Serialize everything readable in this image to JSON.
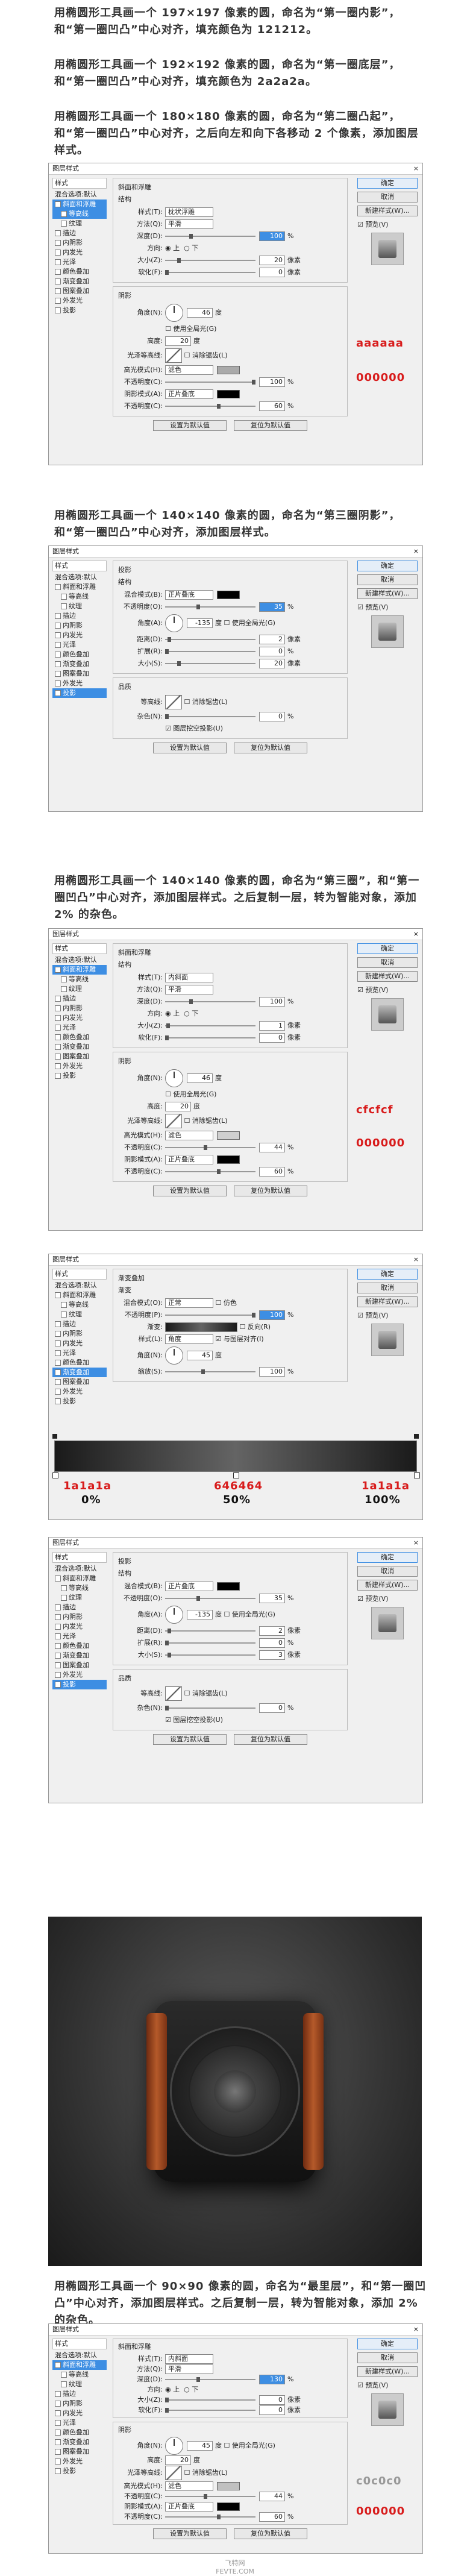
{
  "step1": {
    "p1": "用椭圆形工具画一个 197×197 像素的圆，命名为“第一圈内影”，和“第一圈凹凸”中心对齐，填充颜色为 121212。",
    "p2": "用椭圆形工具画一个 192×192 像素的圆，命名为“第一圈底层”，和“第一圈凹凸”中心对齐，填充颜色为 2a2a2a。",
    "p3": "用椭圆形工具画一个 180×180 像素的圆，命名为“第二圈凸起”，和“第一圈凹凸”中心对齐，之后向左和向下各移动 2 个像素，添加图层样式。"
  },
  "dialog_common": {
    "title": "图层样式",
    "close": "×",
    "styles_header": "样式",
    "blend_options": "混合选项:默认",
    "items": [
      "斜面和浮雕",
      "等高线",
      "纹理",
      "描边",
      "内阴影",
      "内发光",
      "光泽",
      "颜色叠加",
      "渐变叠加",
      "图案叠加",
      "外发光",
      "投影"
    ],
    "ok": "确定",
    "cancel": "取消",
    "new_style": "新建样式(W)...",
    "preview": "预览(V)",
    "set_default": "设置为默认值",
    "reset_default": "复位为默认值"
  },
  "bevel1": {
    "section": "斜面和浮雕",
    "structure": "结构",
    "style_label": "样式(T):",
    "style_value": "枕状浮雕",
    "method_label": "方法(Q):",
    "method_value": "平滑",
    "depth_label": "深度(D):",
    "depth_value": "100",
    "pct": "%",
    "direction_label": "方向:",
    "up": "上",
    "down": "下",
    "size_label": "大小(Z):",
    "size_value": "20",
    "px": "像素",
    "soften_label": "软化(F):",
    "soften_value": "0",
    "shading": "阴影",
    "angle_label": "角度(N):",
    "angle_value": "46",
    "deg": "度",
    "global_light": "使用全局光(G)",
    "altitude_label": "高度:",
    "altitude_value": "20",
    "gloss_label": "光泽等高线:",
    "anti_alias": "消除锯齿(L)",
    "hl_mode_label": "高光模式(H):",
    "hl_mode_value": "滤色",
    "opacity_label": "不透明度(C):",
    "hl_opacity": "100",
    "sh_mode_label": "阴影模式(A):",
    "sh_mode_value": "正片叠底",
    "sh_opacity_label": "不透明度(C):",
    "sh_opacity": "60",
    "note_hl": "aaaaaa",
    "note_sh": "000000",
    "hl_color": "#aaaaaa",
    "sh_color": "#000000"
  },
  "step2": {
    "p": "用椭圆形工具画一个 140×140 像素的圆，命名为“第三圈阴影”，和“第一圈凹凸”中心对齐，添加图层样式。"
  },
  "shadow1": {
    "section": "投影",
    "structure": "结构",
    "blend_label": "混合模式(B):",
    "blend_value": "正片叠底",
    "opacity_label": "不透明度(O):",
    "opacity_value": "35",
    "angle_label": "角度(A):",
    "angle_value": "-135",
    "global_light": "使用全局光(G)",
    "distance_label": "距离(D):",
    "distance_value": "2",
    "spread_label": "扩展(R):",
    "spread_value": "0",
    "size_label": "大小(S):",
    "size_value": "20",
    "quality": "品质",
    "contour_label": "等高线:",
    "anti_alias": "消除锯齿(L)",
    "noise_label": "杂色(N):",
    "noise_value": "0",
    "knockout": "图层挖空投影(U)"
  },
  "step3": {
    "p": "用椭圆形工具画一个 140×140 像素的圆，命名为“第三圈”，和“第一圈凹凸”中心对齐，添加图层样式。之后复制一层，转为智能对象，添加 2% 的杂色。"
  },
  "bevel2": {
    "style_value": "内斜面",
    "method_value": "平滑",
    "depth_value": "100",
    "size_value": "1",
    "soften_value": "0",
    "angle_value": "46",
    "altitude_value": "20",
    "hl_opacity": "44",
    "sh_opacity": "60",
    "note_hl": "cfcfcf",
    "note_sh": "000000",
    "hl_color": "#cfcfcf",
    "sh_color": "#000000"
  },
  "gradient": {
    "section": "渐变叠加",
    "sub": "渐变",
    "blend_label": "混合模式(O):",
    "blend_value": "正常",
    "dither": "仿色",
    "opacity_label": "不透明度(P):",
    "opacity_value": "100",
    "grad_label": "渐变:",
    "reverse": "反向(R)",
    "style_label": "样式(L):",
    "style_value": "角度",
    "align": "与图层对齐(I)",
    "angle_label": "角度(N):",
    "angle_value": "45",
    "scale_label": "缩放(S):",
    "scale_value": "100",
    "stop1": "1a1a1a",
    "stop1_pct": "0%",
    "stop2": "646464",
    "stop2_pct": "50%",
    "stop3": "1a1a1a",
    "stop3_pct": "100%"
  },
  "shadow2": {
    "opacity_value": "35",
    "angle_value": "-135",
    "distance_value": "2",
    "spread_value": "0",
    "size_value": "3",
    "noise_value": "0"
  },
  "step4": {
    "p": "用椭圆形工具画一个 90×90 像素的圆，命名为“最里层”，和“第一圈凹凸”中心对齐，添加图层样式。之后复制一层，转为智能对象，添加 2% 的杂色。"
  },
  "bevel3": {
    "style_value": "内斜面",
    "method_value": "平滑",
    "depth_value": "130",
    "size_value": "0",
    "soften_value": "0",
    "angle_value": "45",
    "altitude_value": "20",
    "hl_opacity": "44",
    "sh_opacity": "60",
    "note_hl": "c0c0c0",
    "note_sh": "000000",
    "hl_color": "#c0c0c0",
    "sh_color": "#000000"
  },
  "watermark": "飞特网\nFEVTE.COM"
}
